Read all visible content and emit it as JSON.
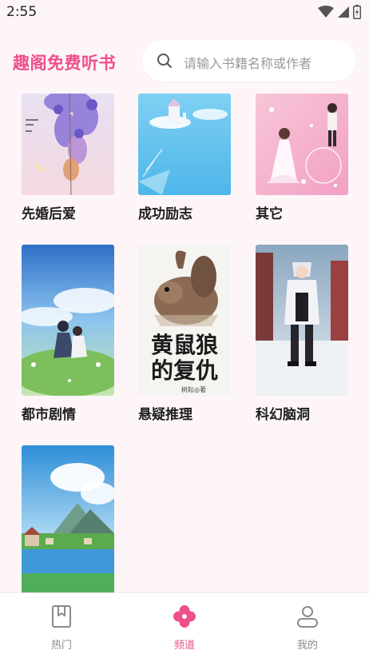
{
  "status_bar": {
    "time": "2:55",
    "icons": [
      "wifi-icon",
      "cellular-signal-icon",
      "battery-icon"
    ]
  },
  "header": {
    "app_title": "趣阁免费听书",
    "search_placeholder": "请输入书籍名称或作者",
    "search_icon": "search-icon"
  },
  "categories": [
    {
      "label": "先婚后爱",
      "cover_theme": "purple-wisteria-moon"
    },
    {
      "label": "成功励志",
      "cover_theme": "sky-blue-clouds-castle"
    },
    {
      "label": "其它",
      "cover_theme": "pink-wedding-couple"
    },
    {
      "label": "都市剧情",
      "cover_theme": "anime-couple-meadow-sky"
    },
    {
      "label": "悬疑推理",
      "cover_theme": "squirrel-creature-book-cover"
    },
    {
      "label": "科幻脑洞",
      "cover_theme": "white-hair-anime-boy-snow-street"
    },
    {
      "label": "",
      "cover_theme": "mountain-lake-village"
    }
  ],
  "book_covers": {
    "suspense": {
      "title_line1": "黄鼠狼",
      "title_line2": "的复仇",
      "author": "树耘◎著"
    }
  },
  "bottom_nav": {
    "items": [
      {
        "label": "热门",
        "icon": "bookmark-book-icon",
        "active": false
      },
      {
        "label": "频道",
        "icon": "four-petal-flower-icon",
        "active": true
      },
      {
        "label": "我的",
        "icon": "user-profile-icon",
        "active": false
      }
    ]
  },
  "colors": {
    "accent": "#ef4f8a",
    "background": "#fdf5f8",
    "nav_inactive": "#8a8a8a"
  }
}
